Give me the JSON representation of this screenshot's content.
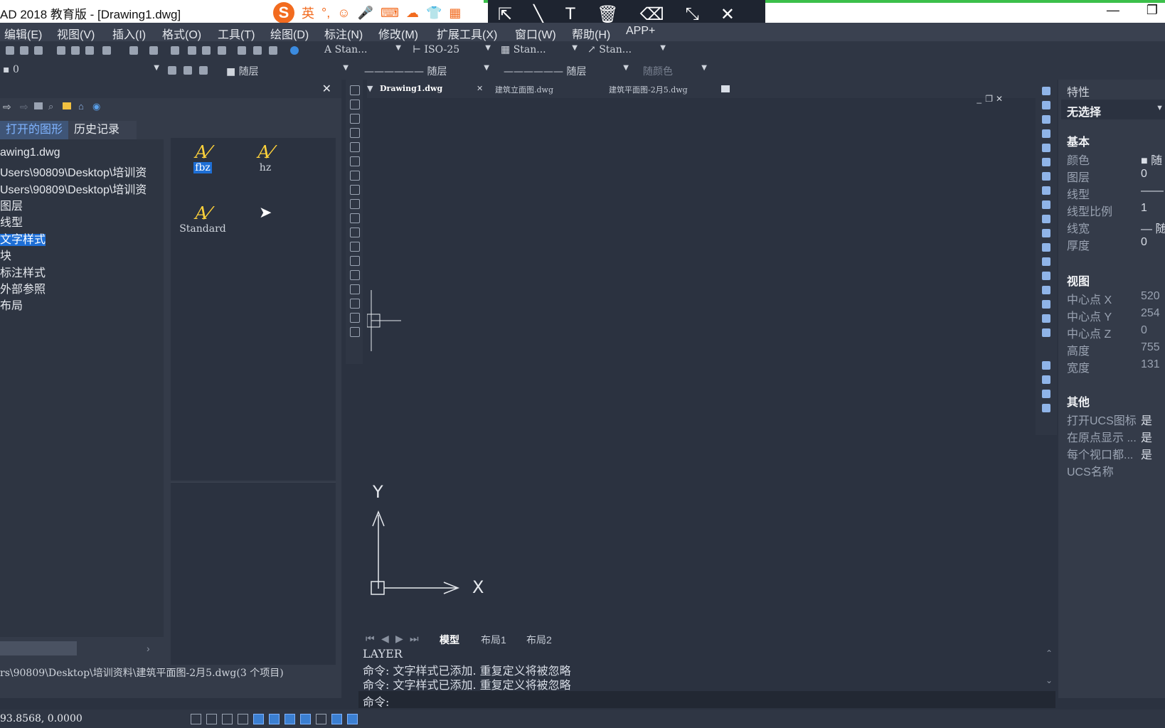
{
  "titlebar": {
    "title": "AD 2018 教育版 - [Drawing1.dwg]",
    "ime": {
      "logo": "S",
      "lang": "英",
      "punct": "°,",
      "emoji": "☺",
      "mic": "🎤",
      "keyboard": "⌨",
      "toolbox": "☁",
      "skin": "👕",
      "grid": "▦"
    },
    "draw_tools": [
      "select-move-icon",
      "line-icon",
      "text-icon",
      "delete-icon",
      "clear-icon",
      "collapse-icon",
      "close-icon"
    ],
    "window_controls": {
      "minimize": "—",
      "restore": "❐"
    }
  },
  "menubar": {
    "items": [
      "编辑(E)",
      "视图(V)",
      "插入(I)",
      "格式(O)",
      "工具(T)",
      "绘图(D)",
      "标注(N)",
      "修改(M)",
      "扩展工具(X)",
      "窗口(W)",
      "帮助(H)",
      "APP+"
    ]
  },
  "toolbar": {
    "text_style": "Stan...",
    "dim_style": "ISO-25",
    "table_style": "Stan...",
    "multileader_style": "Stan...",
    "layer_current": "0",
    "color": "随层",
    "linetype": "随层",
    "lineweight": "随层",
    "plotstyle": "随颜色"
  },
  "design_center": {
    "tabs": [
      "打开的图形",
      "历史记录"
    ],
    "tree": [
      "awing1.dwg",
      "Users\\90809\\Desktop\\培训资",
      "Users\\90809\\Desktop\\培训资",
      "图层",
      "线型",
      "文字样式",
      "块",
      "标注样式",
      "外部参照",
      "布局"
    ],
    "selected_tree_index": 5,
    "styles": [
      {
        "name": "fbz",
        "selected": true
      },
      {
        "name": "hz",
        "selected": false
      },
      {
        "name": "Standard",
        "selected": false
      }
    ],
    "status_path": "rs\\90809\\Desktop\\培训资料\\建筑平面图-2月5.dwg(3 个项目)"
  },
  "documents": {
    "tabs": [
      "Drawing1.dwg",
      "建筑立面图.dwg",
      "建筑平面图-2月5.dwg"
    ],
    "active_index": 0
  },
  "canvas": {
    "ucs_y": "Y",
    "ucs_x": "X"
  },
  "layout_tabs": [
    "模型",
    "布局1",
    "布局2"
  ],
  "command": {
    "history": [
      "LAYER",
      "命令: 文字样式已添加. 重复定义将被忽略",
      "命令: 文字样式已添加. 重复定义将被忽略"
    ],
    "prompt": "命令:"
  },
  "properties": {
    "title": "特性",
    "selection": "无选择",
    "sections": {
      "basic": "基本",
      "view": "视图",
      "other": "其他"
    },
    "basic_rows": [
      {
        "label": "颜色",
        "value": "■ 随"
      },
      {
        "label": "图层",
        "value": "0"
      },
      {
        "label": "线型",
        "value": "——"
      },
      {
        "label": "线型比例",
        "value": "1"
      },
      {
        "label": "线宽",
        "value": "— 随"
      },
      {
        "label": "厚度",
        "value": "0"
      }
    ],
    "view_rows": [
      {
        "label": "中心点 X",
        "value": "520"
      },
      {
        "label": "中心点 Y",
        "value": "254"
      },
      {
        "label": "中心点 Z",
        "value": "0"
      },
      {
        "label": "高度",
        "value": "755"
      },
      {
        "label": "宽度",
        "value": "131"
      }
    ],
    "other_rows": [
      {
        "label": "打开UCS图标",
        "value": "是"
      },
      {
        "label": "在原点显示 ...",
        "value": "是"
      },
      {
        "label": "每个视口都...",
        "value": "是"
      },
      {
        "label": "UCS名称",
        "value": ""
      }
    ]
  },
  "statusbar": {
    "coords": "93.8568, 0.0000"
  }
}
